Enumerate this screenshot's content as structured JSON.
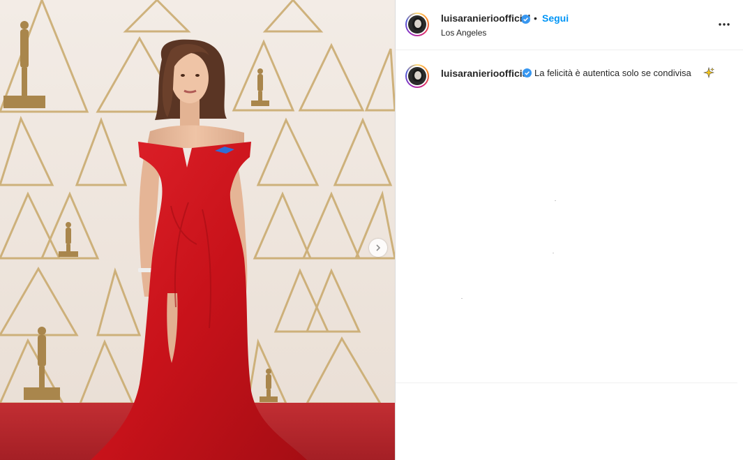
{
  "post": {
    "username": "luisaranierioofficial",
    "follow_label": "Segui",
    "separator": "•",
    "location": "Los Angeles",
    "caption": "La felicità è autentica solo se condivisa"
  },
  "icons": {
    "verified": "verified-badge-icon",
    "more": "more-options-icon",
    "next": "chevron-right-icon",
    "sparkle": "sparkles-icon"
  },
  "colors": {
    "accent": "#0095f6",
    "verified": "#3897f0",
    "dress": "#d5151c",
    "carpet": "#b3262b"
  }
}
